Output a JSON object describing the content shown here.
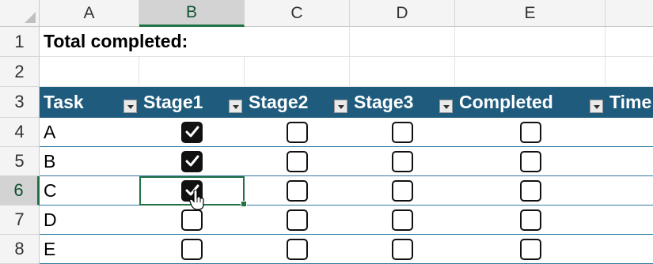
{
  "columns": [
    "A",
    "B",
    "C",
    "D",
    "E"
  ],
  "rows": [
    "1",
    "2",
    "3",
    "4",
    "5",
    "6",
    "7",
    "8"
  ],
  "title": "Total completed:",
  "table": {
    "headers": [
      "Task",
      "Stage1",
      "Stage2",
      "Stage3",
      "Completed",
      "Time"
    ],
    "tasks": [
      {
        "task": "A",
        "stage1": true,
        "stage2": false,
        "stage3": false,
        "completed": false
      },
      {
        "task": "B",
        "stage1": true,
        "stage2": false,
        "stage3": false,
        "completed": false
      },
      {
        "task": "C",
        "stage1": true,
        "stage2": false,
        "stage3": false,
        "completed": false
      },
      {
        "task": "D",
        "stage1": false,
        "stage2": false,
        "stage3": false,
        "completed": false
      },
      {
        "task": "E",
        "stage1": false,
        "stage2": false,
        "stage3": false,
        "completed": false
      }
    ]
  },
  "selection": {
    "column": "B",
    "row": "6"
  },
  "colors": {
    "table_header": "#1e5b7d",
    "selection": "#217346"
  }
}
